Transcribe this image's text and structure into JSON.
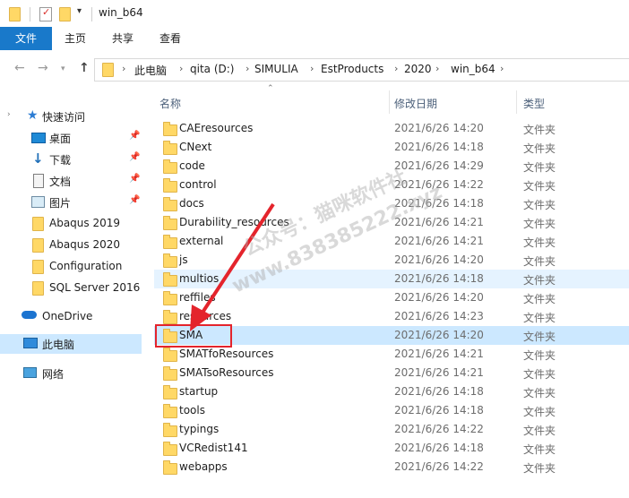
{
  "window": {
    "title": "win_b64"
  },
  "ribbon": {
    "tabs": [
      "文件",
      "主页",
      "共享",
      "查看"
    ]
  },
  "address": {
    "crumbs": [
      "此电脑",
      "qita (D:)",
      "SIMULIA",
      "EstProducts",
      "2020",
      "win_b64"
    ]
  },
  "nav": {
    "quick_access": "快速访问",
    "pinned": [
      {
        "label": "桌面",
        "icon": "desktop-icon"
      },
      {
        "label": "下载",
        "icon": "download-icon"
      },
      {
        "label": "文档",
        "icon": "documents-icon"
      },
      {
        "label": "图片",
        "icon": "pictures-icon"
      }
    ],
    "folders": [
      "Abaqus 2019",
      "Abaqus 2020",
      "Configuration",
      "SQL Server 2016"
    ],
    "onedrive": "OneDrive",
    "this_pc": "此电脑",
    "network": "网络"
  },
  "columns": {
    "name": "名称",
    "date": "修改日期",
    "type": "类型"
  },
  "files": [
    {
      "name": "CAEresources",
      "date": "2021/6/26 14:20",
      "type": "文件夹"
    },
    {
      "name": "CNext",
      "date": "2021/6/26 14:18",
      "type": "文件夹"
    },
    {
      "name": "code",
      "date": "2021/6/26 14:29",
      "type": "文件夹"
    },
    {
      "name": "control",
      "date": "2021/6/26 14:22",
      "type": "文件夹"
    },
    {
      "name": "docs",
      "date": "2021/6/26 14:18",
      "type": "文件夹"
    },
    {
      "name": "Durability_resources",
      "date": "2021/6/26 14:21",
      "type": "文件夹"
    },
    {
      "name": "external",
      "date": "2021/6/26 14:21",
      "type": "文件夹"
    },
    {
      "name": "js",
      "date": "2021/6/26 14:20",
      "type": "文件夹"
    },
    {
      "name": "multios",
      "date": "2021/6/26 14:18",
      "type": "文件夹"
    },
    {
      "name": "reffiles",
      "date": "2021/6/26 14:20",
      "type": "文件夹"
    },
    {
      "name": "resources",
      "date": "2021/6/26 14:23",
      "type": "文件夹"
    },
    {
      "name": "SMA",
      "date": "2021/6/26 14:20",
      "type": "文件夹"
    },
    {
      "name": "SMATfoResources",
      "date": "2021/6/26 14:21",
      "type": "文件夹"
    },
    {
      "name": "SMATsoResources",
      "date": "2021/6/26 14:21",
      "type": "文件夹"
    },
    {
      "name": "startup",
      "date": "2021/6/26 14:18",
      "type": "文件夹"
    },
    {
      "name": "tools",
      "date": "2021/6/26 14:18",
      "type": "文件夹"
    },
    {
      "name": "typings",
      "date": "2021/6/26 14:22",
      "type": "文件夹"
    },
    {
      "name": "VCRedist141",
      "date": "2021/6/26 14:18",
      "type": "文件夹"
    },
    {
      "name": "webapps",
      "date": "2021/6/26 14:22",
      "type": "文件夹"
    }
  ],
  "watermark": {
    "line1": "公众号：猫咪软件社",
    "line2": "www.838385222.xyz"
  },
  "colors": {
    "accent": "#1979ca",
    "selection": "#cce8ff",
    "hover": "#e5f3ff",
    "annotation": "#e4242c"
  }
}
